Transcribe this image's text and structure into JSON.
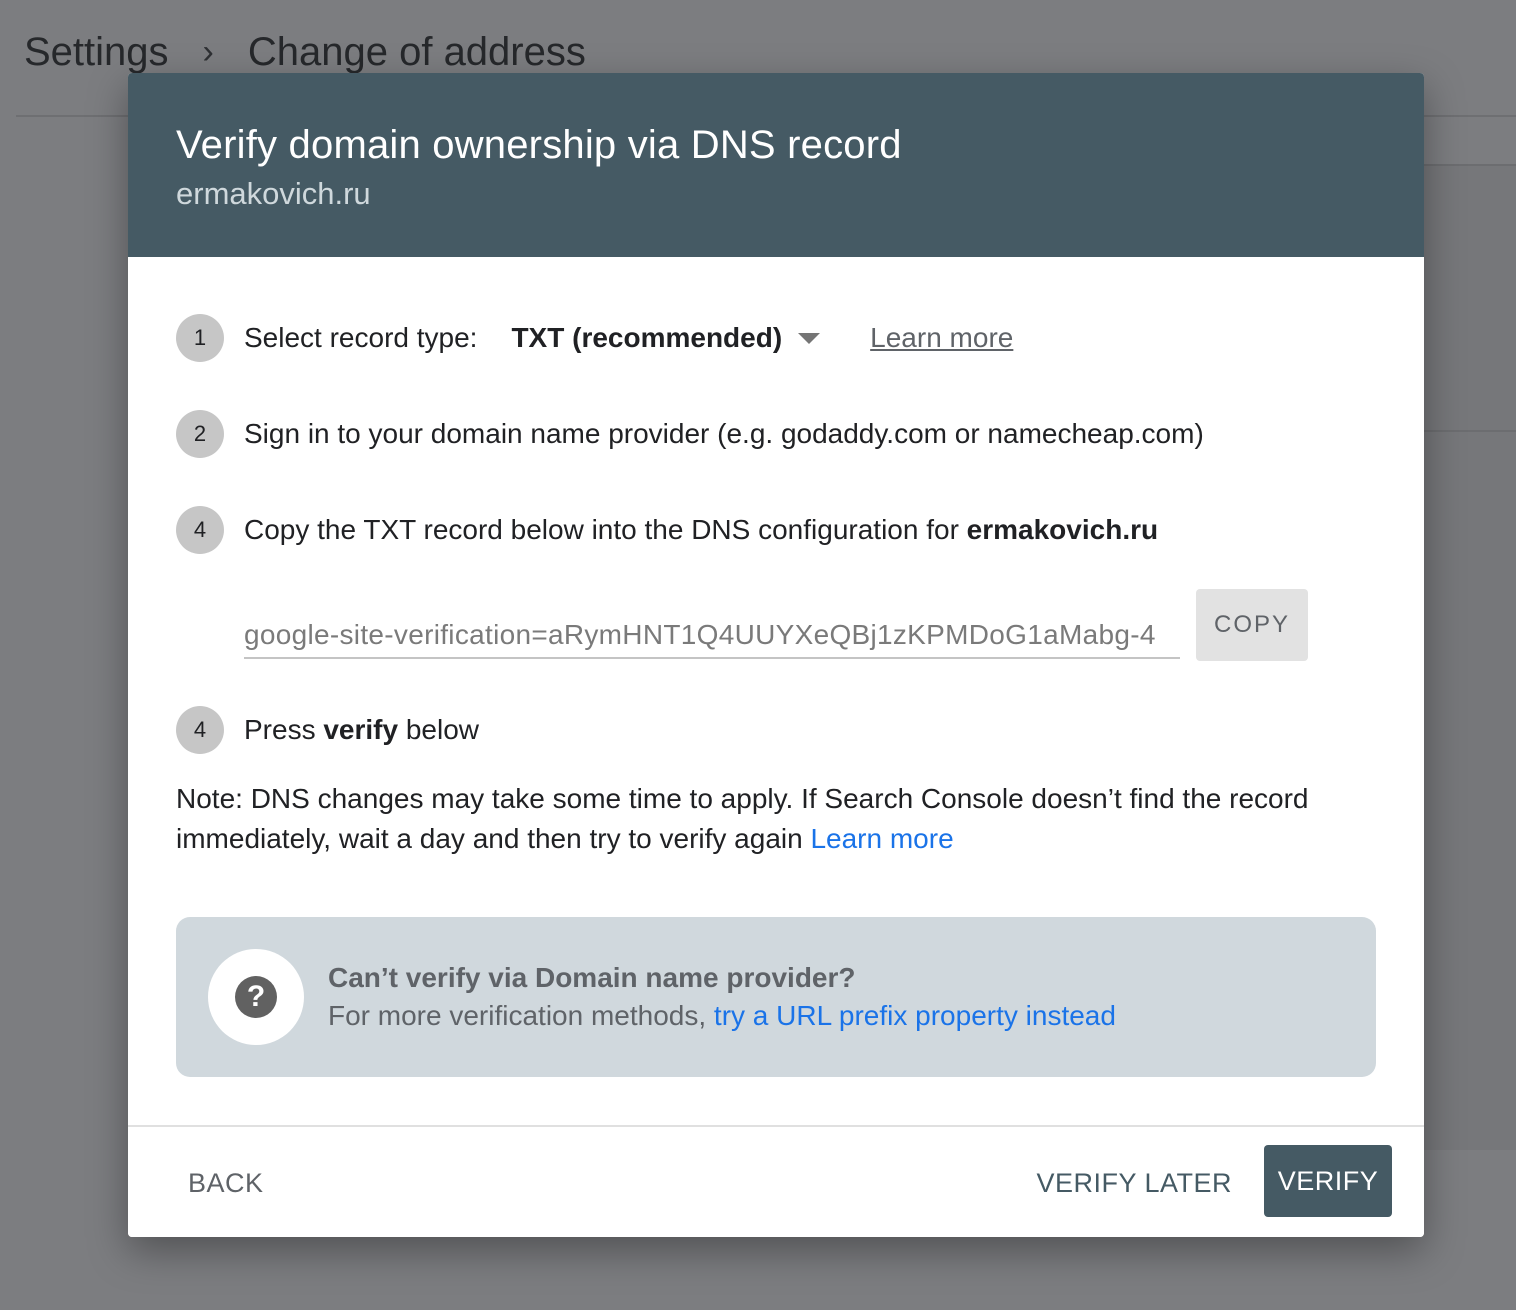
{
  "background": {
    "breadcrumb": {
      "root": "Settings",
      "separator": "›",
      "current": "Change of address"
    }
  },
  "dialog": {
    "title": "Verify domain ownership via DNS record",
    "subtitle": "ermakovich.ru",
    "steps": [
      {
        "number": "1",
        "label": "Select record type:",
        "select_value": "TXT (recommended)",
        "learn_more": "Learn more"
      },
      {
        "number": "2",
        "label": "Sign in to your domain name provider (e.g. godaddy.com or namecheap.com)"
      },
      {
        "number": "4",
        "label_prefix": "Copy the TXT record below into the DNS configuration for ",
        "label_bold": "ermakovich.ru"
      },
      {
        "number": "4",
        "label_prefix": "Press ",
        "label_bold": "verify",
        "label_suffix": " below"
      }
    ],
    "txt_record": "google-site-verification=aRymHNT1Q4UUYXeQBj1zKPMDoG1aMabg-4",
    "copy_label": "COPY",
    "note_text": "Note: DNS changes may take some time to apply. If Search Console doesn’t find the record immediately, wait a day and then try to verify again ",
    "note_link": "Learn more",
    "help": {
      "icon": "help-question-icon",
      "title": "Can’t verify via Domain name provider?",
      "desc_prefix": "For more verification methods, ",
      "desc_link": "try a URL prefix property instead"
    },
    "footer": {
      "back": "BACK",
      "verify_later": "VERIFY LATER",
      "verify": "VERIFY"
    }
  },
  "colors": {
    "header_bg": "#455a64",
    "link": "#1a73e8",
    "help_bg": "#d0d8dd",
    "step_badge": "#c6c6c6"
  }
}
